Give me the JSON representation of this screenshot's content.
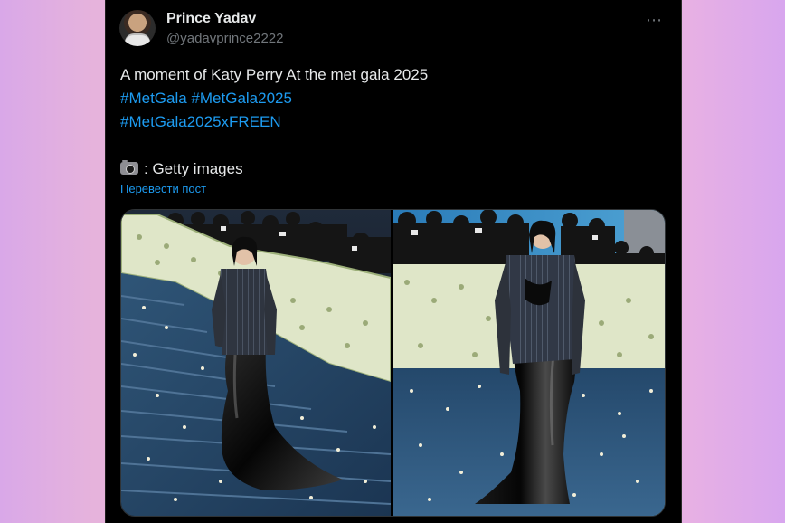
{
  "tweet": {
    "author_name": "Prince Yadav",
    "author_handle": "@yadavprince2222",
    "more_icon": "⋯",
    "lines": [
      "A moment of Katy Perry At the met gala 2025",
      "#MetGala #MetGala2025",
      "#MetGala2025xFREEN"
    ],
    "credit_text": ": Getty images",
    "credit_icon": "camera-flash-icon",
    "translate_label": "Перевести пост"
  },
  "colors": {
    "background": "#000000",
    "text": "#e7e9ea",
    "secondary": "#71767b",
    "link": "#1d9bf0"
  }
}
